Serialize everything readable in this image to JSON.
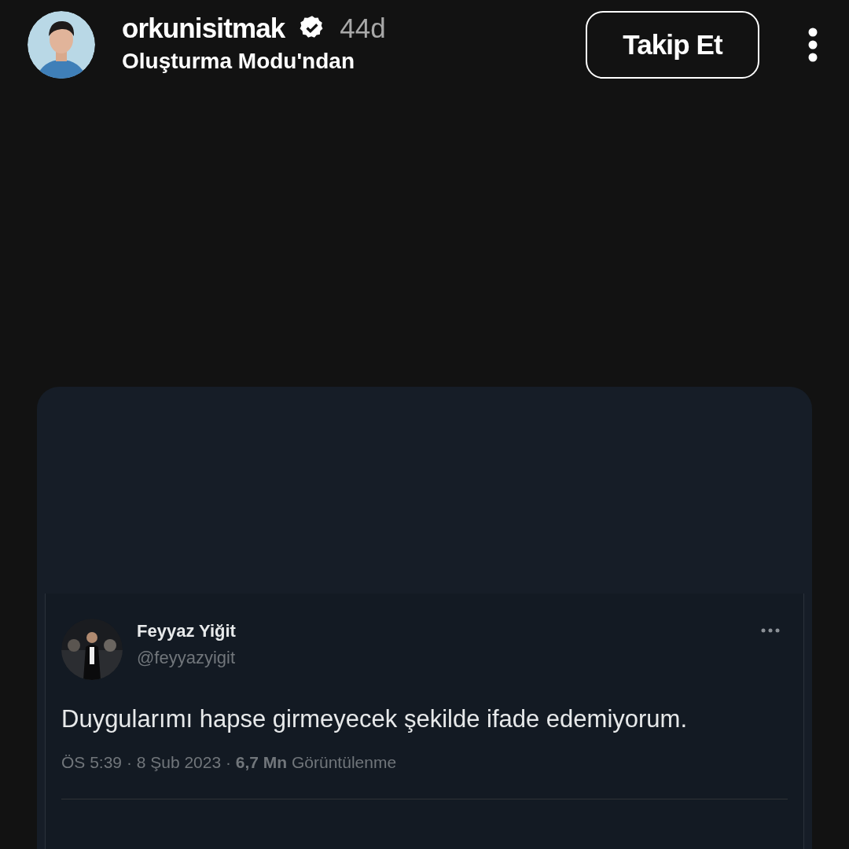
{
  "post_header": {
    "username": "orkunisitmak",
    "verified": true,
    "time": "44d",
    "subtitle": "Oluşturma Modu'ndan",
    "follow_button": "Takip Et"
  },
  "tweet": {
    "name": "Feyyaz Yiğit",
    "handle": "@feyyazyigit",
    "text": "Duygularımı hapse girmeyecek şekilde ifade edemiyorum.",
    "meta": "ÖS 5:39 · 8 Şub 2023 · **6,7 Mn** Görüntülenme"
  }
}
